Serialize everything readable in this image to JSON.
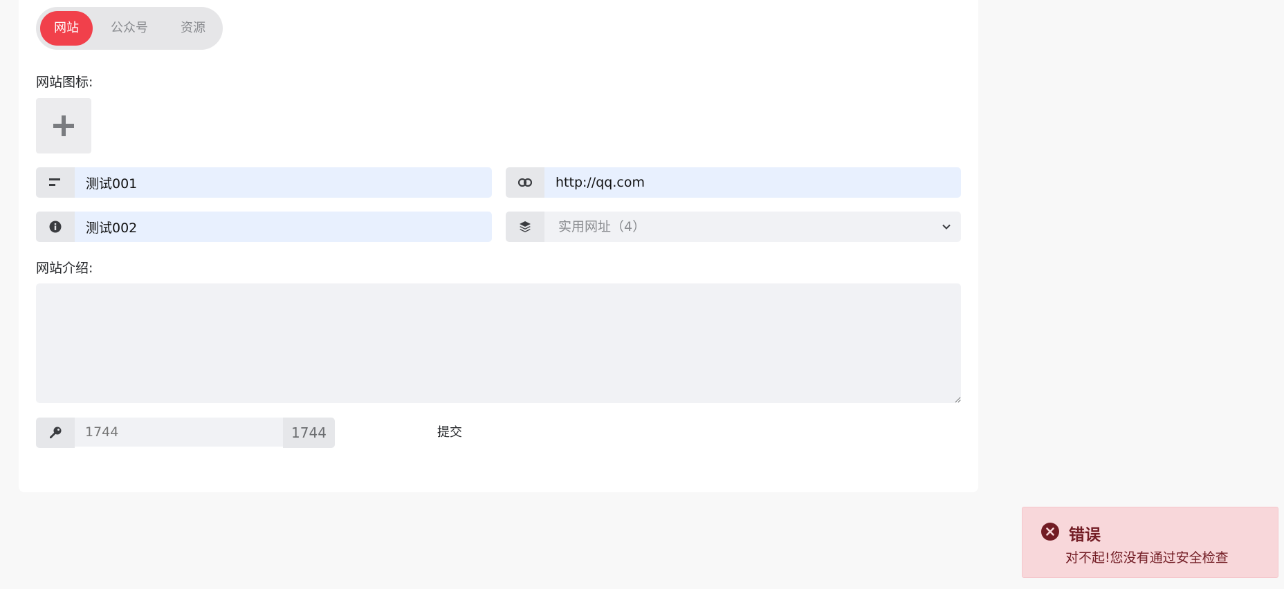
{
  "tabs": [
    {
      "label": "网站",
      "active": true
    },
    {
      "label": "公众号",
      "active": false
    },
    {
      "label": "资源",
      "active": false
    }
  ],
  "form": {
    "icon_label": "网站图标:",
    "name_value": "测试001",
    "url_value": "http://qq.com",
    "desc_short_value": "测试002",
    "category_selected": "实用网址（4）",
    "intro_label": "网站介绍:",
    "intro_value": "",
    "captcha_placeholder": "1744",
    "captcha_code": "1744",
    "submit_label": "提交"
  },
  "toast": {
    "title": "错误",
    "message": "对不起!您没有通过安全检查"
  },
  "colors": {
    "accent": "#f1404b",
    "filled_input": "#e8f0fe",
    "error_bg": "#f8d7da",
    "error_text": "#721c24"
  },
  "icons": [
    "plus-icon",
    "text-lines-icon",
    "link-icon",
    "info-icon",
    "layers-icon",
    "chevron-down-icon",
    "key-icon",
    "close-circle-icon"
  ]
}
